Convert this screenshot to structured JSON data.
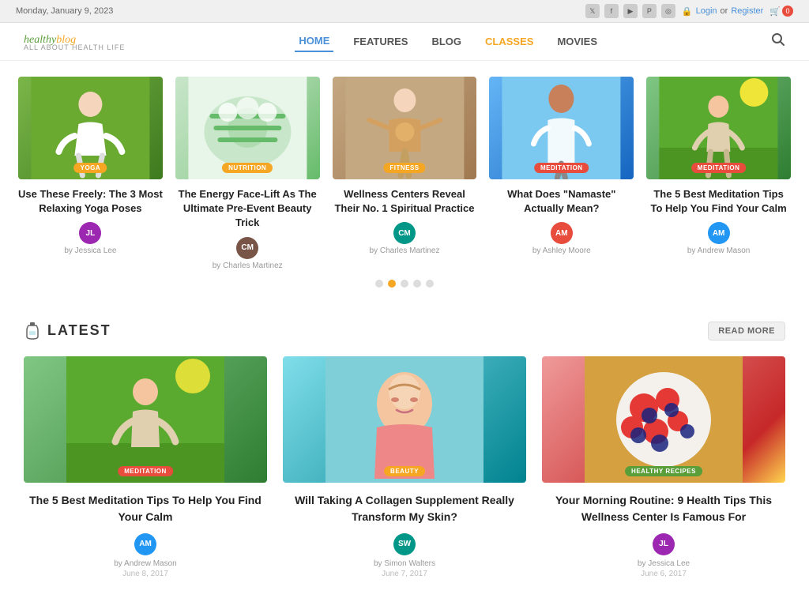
{
  "topbar": {
    "date": "Monday, January 9, 2023",
    "login": "Login",
    "or": "or",
    "register": "Register",
    "social": [
      "t",
      "f",
      "y",
      "p",
      "i"
    ],
    "cart_count": "0"
  },
  "header": {
    "logo_healthy": "healthy",
    "logo_blog": "blog",
    "logo_tagline": "ALL ABOUT HEALTH LIFE",
    "nav": [
      {
        "label": "HOME",
        "active": true
      },
      {
        "label": "FEATURES",
        "active": false
      },
      {
        "label": "BLOG",
        "active": false
      },
      {
        "label": "CLASSES",
        "active": false,
        "special": "orange"
      },
      {
        "label": "MOVIES",
        "active": false
      }
    ]
  },
  "carousel": {
    "items": [
      {
        "category": "YOGA",
        "badge_color": "#f5a623",
        "title": "Use These Freely: The 3 Most Relaxing Yoga Poses",
        "author": "Jessica Lee",
        "author_initials": "JL",
        "av_class": "av-purple"
      },
      {
        "category": "NUTRITION",
        "badge_color": "#f5a623",
        "title": "The Energy Face-Lift As The Ultimate Pre-Event Beauty Trick",
        "author": "Charles Martinez",
        "author_initials": "CM",
        "av_class": "av-brown"
      },
      {
        "category": "FITNESS",
        "badge_color": "#f5a623",
        "title": "Wellness Centers Reveal Their No. 1 Spiritual Practice",
        "author": "Charles Martinez",
        "author_initials": "CM",
        "av_class": "av-teal"
      },
      {
        "category": "MEDITATION",
        "badge_color": "#e74c3c",
        "title": "What Does \"Namaste\" Actually Mean?",
        "author": "Ashley Moore",
        "author_initials": "AM",
        "av_class": "av-red"
      },
      {
        "category": "MEDITATION",
        "badge_color": "#e74c3c",
        "title": "The 5 Best Meditation Tips To Help You Find Your Calm",
        "author": "Andrew Mason",
        "author_initials": "AM",
        "av_class": "av-blue"
      }
    ],
    "pagination": [
      1,
      2,
      3,
      4,
      5
    ],
    "active_dot": 1
  },
  "latest": {
    "section_label": "LATEST",
    "read_more": "READ MORE",
    "items": [
      {
        "category": "MEDITATION",
        "badge_color": "#e74c3c",
        "title": "The 5 Best Meditation Tips To Help You Find Your Calm",
        "author": "Andrew Mason",
        "author_initials": "AM",
        "av_class": "av-blue",
        "date": "June 8, 2017",
        "img_class": "img-latest-meditation"
      },
      {
        "category": "BEAUTY",
        "badge_color": "#f5a623",
        "title": "Will Taking A Collagen Supplement Really Transform My Skin?",
        "author": "Simon Walters",
        "author_initials": "SW",
        "av_class": "av-teal",
        "date": "June 7, 2017",
        "img_class": "img-latest-beauty"
      },
      {
        "category": "HEALTHY RECIPES",
        "badge_color": "#5a9e3a",
        "title": "Your Morning Routine: 9 Health Tips This Wellness Center Is Famous For",
        "author": "Jessica Lee",
        "author_initials": "JL",
        "av_class": "av-purple",
        "date": "June 6, 2017",
        "img_class": "img-latest-recipes"
      }
    ]
  }
}
